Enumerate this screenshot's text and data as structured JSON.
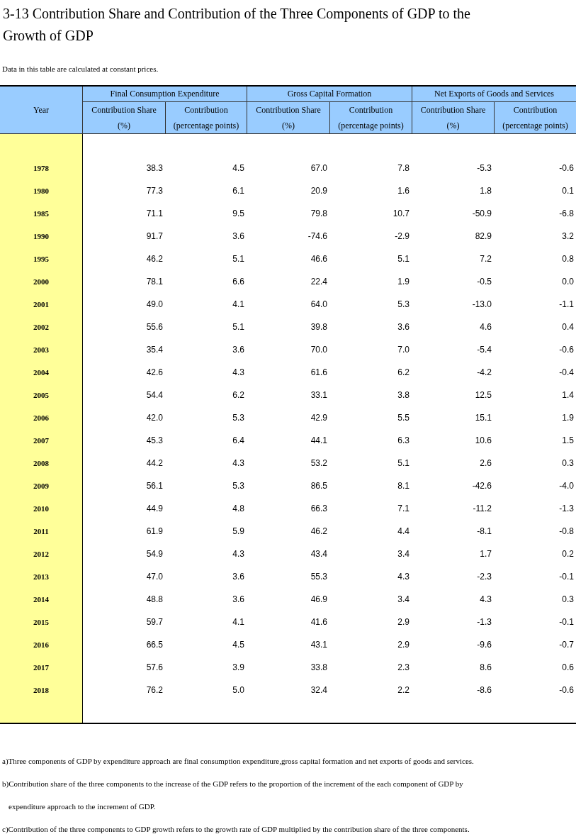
{
  "title": "3-13  Contribution Share and Contribution of the Three Components of GDP to the Growth of GDP",
  "subtitle": "Data in this table are calculated at constant prices.",
  "table": {
    "year_header": "Year",
    "groups": [
      {
        "label": "Final Consumption Expenditure",
        "columns": [
          {
            "name": "Contribution Share",
            "unit": "(%)"
          },
          {
            "name": "Contribution",
            "unit": "(percentage points)"
          }
        ]
      },
      {
        "label": "Gross Capital Formation",
        "columns": [
          {
            "name": "Contribution Share",
            "unit": "(%)"
          },
          {
            "name": "Contribution",
            "unit": "(percentage points)"
          }
        ]
      },
      {
        "label": "Net Exports of Goods and Services",
        "columns": [
          {
            "name": "Contribution Share",
            "unit": "(%)"
          },
          {
            "name": "Contribution",
            "unit": "(percentage points)"
          }
        ]
      }
    ],
    "rows": [
      {
        "year": "1978",
        "values": [
          "38.3",
          "4.5",
          "67.0",
          "7.8",
          "-5.3",
          "-0.6"
        ]
      },
      {
        "year": "1980",
        "values": [
          "77.3",
          "6.1",
          "20.9",
          "1.6",
          "1.8",
          "0.1"
        ]
      },
      {
        "year": "1985",
        "values": [
          "71.1",
          "9.5",
          "79.8",
          "10.7",
          "-50.9",
          "-6.8"
        ]
      },
      {
        "year": "1990",
        "values": [
          "91.7",
          "3.6",
          "-74.6",
          "-2.9",
          "82.9",
          "3.2"
        ]
      },
      {
        "year": "1995",
        "values": [
          "46.2",
          "5.1",
          "46.6",
          "5.1",
          "7.2",
          "0.8"
        ]
      },
      {
        "year": "2000",
        "values": [
          "78.1",
          "6.6",
          "22.4",
          "1.9",
          "-0.5",
          "0.0"
        ]
      },
      {
        "year": "2001",
        "values": [
          "49.0",
          "4.1",
          "64.0",
          "5.3",
          "-13.0",
          "-1.1"
        ]
      },
      {
        "year": "2002",
        "values": [
          "55.6",
          "5.1",
          "39.8",
          "3.6",
          "4.6",
          "0.4"
        ]
      },
      {
        "year": "2003",
        "values": [
          "35.4",
          "3.6",
          "70.0",
          "7.0",
          "-5.4",
          "-0.6"
        ]
      },
      {
        "year": "2004",
        "values": [
          "42.6",
          "4.3",
          "61.6",
          "6.2",
          "-4.2",
          "-0.4"
        ]
      },
      {
        "year": "2005",
        "values": [
          "54.4",
          "6.2",
          "33.1",
          "3.8",
          "12.5",
          "1.4"
        ]
      },
      {
        "year": "2006",
        "values": [
          "42.0",
          "5.3",
          "42.9",
          "5.5",
          "15.1",
          "1.9"
        ]
      },
      {
        "year": "2007",
        "values": [
          "45.3",
          "6.4",
          "44.1",
          "6.3",
          "10.6",
          "1.5"
        ]
      },
      {
        "year": "2008",
        "values": [
          "44.2",
          "4.3",
          "53.2",
          "5.1",
          "2.6",
          "0.3"
        ]
      },
      {
        "year": "2009",
        "values": [
          "56.1",
          "5.3",
          "86.5",
          "8.1",
          "-42.6",
          "-4.0"
        ]
      },
      {
        "year": "2010",
        "values": [
          "44.9",
          "4.8",
          "66.3",
          "7.1",
          "-11.2",
          "-1.3"
        ]
      },
      {
        "year": "2011",
        "values": [
          "61.9",
          "5.9",
          "46.2",
          "4.4",
          "-8.1",
          "-0.8"
        ]
      },
      {
        "year": "2012",
        "values": [
          "54.9",
          "4.3",
          "43.4",
          "3.4",
          "1.7",
          "0.2"
        ]
      },
      {
        "year": "2013",
        "values": [
          "47.0",
          "3.6",
          "55.3",
          "4.3",
          "-2.3",
          "-0.1"
        ]
      },
      {
        "year": "2014",
        "values": [
          "48.8",
          "3.6",
          "46.9",
          "3.4",
          "4.3",
          "0.3"
        ]
      },
      {
        "year": "2015",
        "values": [
          "59.7",
          "4.1",
          "41.6",
          "2.9",
          "-1.3",
          "-0.1"
        ]
      },
      {
        "year": "2016",
        "values": [
          "66.5",
          "4.5",
          "43.1",
          "2.9",
          "-9.6",
          "-0.7"
        ]
      },
      {
        "year": "2017",
        "values": [
          "57.6",
          "3.9",
          "33.8",
          "2.3",
          "8.6",
          "0.6"
        ]
      },
      {
        "year": "2018",
        "values": [
          "76.2",
          "5.0",
          "32.4",
          "2.2",
          "-8.6",
          "-0.6"
        ]
      }
    ]
  },
  "notes": [
    "a)Three components of GDP by expenditure approach are final consumption expenditure,gross capital formation and net exports of goods and services.",
    "b)Contribution share of the three components to the increase of the GDP refers to the proportion of the increment of the each component of GDP by",
    "expenditure approach to the increment of GDP.",
    "c)Contribution of the three components to GDP growth refers to the growth rate of GDP multiplied by the contribution share of the three components."
  ]
}
